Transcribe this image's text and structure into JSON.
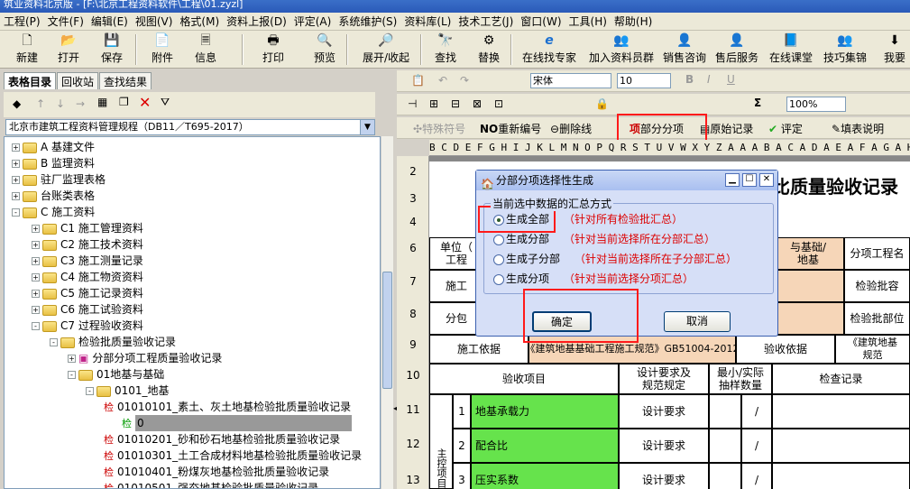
{
  "app": {
    "title": "筑业资料北京版 - [F:\\北京工程资料软件\\工程\\01.zyzl]"
  },
  "menu": [
    "工程(P)",
    "文件(F)",
    "编辑(E)",
    "视图(V)",
    "格式(M)",
    "资料上报(D)",
    "评定(A)",
    "系统维护(S)",
    "资料库(L)",
    "技术工艺(J)",
    "窗口(W)",
    "工具(H)",
    "帮助(H)"
  ],
  "toolbar": [
    {
      "label": "新建",
      "icon": "new-icon",
      "glyph": "🗋"
    },
    {
      "label": "打开",
      "icon": "open-icon",
      "glyph": "📂"
    },
    {
      "label": "保存",
      "icon": "save-icon",
      "glyph": "💾"
    },
    {
      "label": "附件",
      "icon": "attach-icon",
      "glyph": "📄"
    },
    {
      "label": "信息",
      "icon": "info-icon",
      "glyph": "🗏"
    },
    {
      "label": "打印",
      "icon": "print-icon",
      "glyph": "🖶"
    },
    {
      "label": "预览",
      "icon": "preview-icon",
      "glyph": "🔍"
    },
    {
      "label": "展开/收起",
      "icon": "expand-icon",
      "glyph": "🔎"
    },
    {
      "label": "查找",
      "icon": "find-icon",
      "glyph": "🔭"
    },
    {
      "label": "替换",
      "icon": "replace-icon",
      "glyph": "⚙"
    },
    {
      "label": "在线找专家",
      "icon": "expert-icon",
      "glyph": "e"
    },
    {
      "label": "加入资料员群",
      "icon": "group-icon",
      "glyph": "👥"
    },
    {
      "label": "销售咨询",
      "icon": "sales-icon",
      "glyph": "👤"
    },
    {
      "label": "售后服务",
      "icon": "service-icon",
      "glyph": "👤"
    },
    {
      "label": "在线课堂",
      "icon": "class-icon",
      "glyph": "📘"
    },
    {
      "label": "技巧集锦",
      "icon": "tips-icon",
      "glyph": "👥"
    },
    {
      "label": "我要",
      "icon": "want-icon",
      "glyph": "⬇"
    }
  ],
  "left_tabs": [
    "表格目录",
    "回收站",
    "查找结果"
  ],
  "spec_combo": "北京市建筑工程资料管理规程（DB11／T695-2017）",
  "tree": [
    {
      "label": "A 基建文件"
    },
    {
      "label": "B 监理资料"
    },
    {
      "label": "驻厂监理表格"
    },
    {
      "label": "台账类表格"
    },
    {
      "label": "C 施工资料"
    },
    {
      "label": "C1 施工管理资料"
    },
    {
      "label": "C2 施工技术资料"
    },
    {
      "label": "C3 施工测量记录"
    },
    {
      "label": "C4 施工物资资料"
    },
    {
      "label": "C5 施工记录资料"
    },
    {
      "label": "C6 施工试验资料"
    },
    {
      "label": "C7 过程验收资料"
    },
    {
      "label": "检验批质量验收记录"
    },
    {
      "label": "分部分项工程质量验收记录"
    },
    {
      "label": "01地基与基础"
    },
    {
      "label": "0101_地基"
    },
    {
      "label": "01010101_素土、灰土地基检验批质量验收记录",
      "tag": "检"
    },
    {
      "label": "0",
      "tag": "检"
    },
    {
      "label": "01010201_砂和砂石地基检验批质量验收记录",
      "tag": "检"
    },
    {
      "label": "01010301_土工合成材料地基检验批质量验收记录",
      "tag": "检"
    },
    {
      "label": "01010401_粉煤灰地基检验批质量验收记录",
      "tag": "检"
    },
    {
      "label": "01010501_强夯地基检验批质量验收记录",
      "tag": "检"
    }
  ],
  "editor": {
    "font": "宋体",
    "size": "10",
    "zoom": "100%",
    "tb3": [
      "特殊符号",
      "重新编号",
      "删除线",
      "部分分项",
      "原始记录",
      "评定",
      "填表说明"
    ],
    "columns": "B C D E F G H I J K L M N O P Q R S T U V W X Y Z A A A B A C A D A E A F A G A H A I A J A K A L A M A N A O A P",
    "rows": [
      "2",
      "3",
      "4",
      "6",
      "7",
      "8",
      "9",
      "10",
      "11",
      "12",
      "13"
    ]
  },
  "sheet": {
    "title": "比质量验收记录",
    "unit_label": "单位（",
    "unit_label2": "工程",
    "sub_label": "施工",
    "sub_label2": "分包",
    "basis": "施工依据",
    "basis_val": "《建筑地基基础工程施工规范》GB51004-2012",
    "basis_val_short": "2012",
    "accept_basis": "验收依据",
    "accept_basis_val": "《建筑地基",
    "accept_basis_val2": "规范",
    "foundation": "与基础/",
    "foundation2": "地基",
    "subitem_name": "分项工程名",
    "capacity": "检验批容",
    "part": "检验批部位",
    "col_item": "验收项目",
    "col_design": "设计要求及\n规范规定",
    "col_min": "最小/实际\n抽样数量",
    "col_check": "检查记录",
    "main_ctrl": "主控项目",
    "items": [
      {
        "no": "1",
        "name": "地基承载力",
        "req": "设计要求",
        "slash": "/"
      },
      {
        "no": "2",
        "name": "配合比",
        "req": "设计要求",
        "slash": "/"
      },
      {
        "no": "3",
        "name": "压实系数",
        "req": "设计要求",
        "slash": "/"
      }
    ]
  },
  "dialog": {
    "title": "分部分项选择性生成",
    "group": "当前选中数据的汇总方式",
    "options": [
      {
        "label": "生成全部",
        "note": "（针对所有检验批汇总）",
        "checked": true
      },
      {
        "label": "生成分部",
        "note": "（针对当前选择所在分部汇总）",
        "checked": false
      },
      {
        "label": "生成子分部",
        "note": "（针对当前选择所在子分部汇总）",
        "checked": false
      },
      {
        "label": "生成分项",
        "note": "（针对当前选择分项汇总）",
        "checked": false
      }
    ],
    "ok": "确定",
    "cancel": "取消"
  },
  "colors": {
    "highlight": "#ff1a1a",
    "green": "#66e34c",
    "tan": "#f6d6b8"
  }
}
